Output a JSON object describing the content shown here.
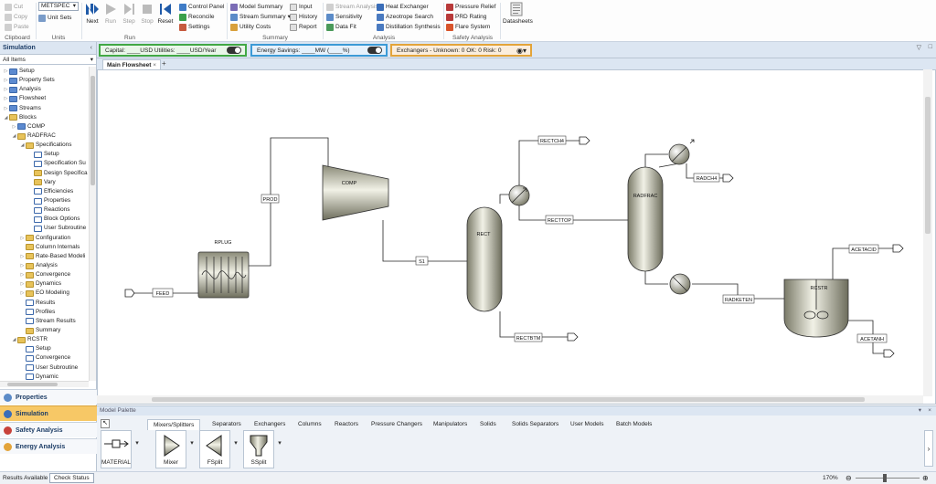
{
  "ribbon": {
    "clipboard": {
      "cut": "Cut",
      "copy": "Copy",
      "paste": "Paste",
      "label": "Clipboard"
    },
    "units": {
      "selected": "METSPEC",
      "unit_sets": "Unit Sets",
      "label": "Units"
    },
    "run": {
      "next": "Next",
      "run": "Run",
      "step": "Step",
      "stop": "Stop",
      "reset": "Reset",
      "label": "Run"
    },
    "run_extra": {
      "control_panel": "Control Panel",
      "reconcile": "Reconcile",
      "settings": "Settings"
    },
    "summary": {
      "model_summary": "Model Summary",
      "stream_summary": "Stream Summary",
      "utility_costs": "Utility Costs",
      "input": "Input",
      "history": "History",
      "report": "Report",
      "label": "Summary"
    },
    "analysis": {
      "stream_analysis": "Stream Analysis",
      "sensitivity": "Sensitivity",
      "data_fit": "Data Fit",
      "heat_exchanger": "Heat Exchanger",
      "azeotrope_search": "Azeotrope Search",
      "distillation_synthesis": "Distillation Synthesis",
      "label": "Analysis"
    },
    "safety": {
      "pressure_relief": "Pressure Relief",
      "prd_rating": "PRD Rating",
      "flare_system": "Flare System",
      "label": "Safety Analysis"
    },
    "datasheets": "Datasheets"
  },
  "navigator": {
    "title": "Simulation",
    "filter": "All Items",
    "tree": [
      {
        "label": "Setup",
        "depth": 0,
        "toggle": "▷",
        "icon": "folder-icon"
      },
      {
        "label": "Property Sets",
        "depth": 0,
        "toggle": "▷",
        "icon": "folder-icon"
      },
      {
        "label": "Analysis",
        "depth": 0,
        "toggle": "▷",
        "icon": "folder-icon"
      },
      {
        "label": "Flowsheet",
        "depth": 0,
        "toggle": "▷",
        "icon": "folder-icon"
      },
      {
        "label": "Streams",
        "depth": 0,
        "toggle": "▷",
        "icon": "folder-icon"
      },
      {
        "label": "Blocks",
        "depth": 0,
        "toggle": "◢",
        "icon": "folder-open-icon"
      },
      {
        "label": "COMP",
        "depth": 1,
        "toggle": "▷",
        "icon": "folder-icon"
      },
      {
        "label": "RADFRAC",
        "depth": 1,
        "toggle": "◢",
        "icon": "folder-open-icon"
      },
      {
        "label": "Specifications",
        "depth": 2,
        "toggle": "◢",
        "icon": "folder-open-icon"
      },
      {
        "label": "Setup",
        "depth": 3,
        "toggle": "",
        "icon": "form-icon"
      },
      {
        "label": "Specification Su",
        "depth": 3,
        "toggle": "",
        "icon": "form-icon"
      },
      {
        "label": "Design Specifica",
        "depth": 3,
        "toggle": "",
        "icon": "folder-open-icon"
      },
      {
        "label": "Vary",
        "depth": 3,
        "toggle": "",
        "icon": "folder-open-icon"
      },
      {
        "label": "Efficiencies",
        "depth": 3,
        "toggle": "",
        "icon": "form-icon"
      },
      {
        "label": "Properties",
        "depth": 3,
        "toggle": "",
        "icon": "form-icon"
      },
      {
        "label": "Reactions",
        "depth": 3,
        "toggle": "",
        "icon": "form-icon"
      },
      {
        "label": "Block Options",
        "depth": 3,
        "toggle": "",
        "icon": "form-icon"
      },
      {
        "label": "User Subroutine",
        "depth": 3,
        "toggle": "",
        "icon": "form-icon"
      },
      {
        "label": "Configuration",
        "depth": 2,
        "toggle": "▷",
        "icon": "folder-open-icon"
      },
      {
        "label": "Column Internals",
        "depth": 2,
        "toggle": "",
        "icon": "folder-open-icon"
      },
      {
        "label": "Rate-Based Modeli",
        "depth": 2,
        "toggle": "▷",
        "icon": "folder-open-icon"
      },
      {
        "label": "Analysis",
        "depth": 2,
        "toggle": "▷",
        "icon": "folder-open-icon"
      },
      {
        "label": "Convergence",
        "depth": 2,
        "toggle": "▷",
        "icon": "folder-open-icon"
      },
      {
        "label": "Dynamics",
        "depth": 2,
        "toggle": "▷",
        "icon": "folder-open-icon"
      },
      {
        "label": "EO Modeling",
        "depth": 2,
        "toggle": "▷",
        "icon": "folder-open-icon"
      },
      {
        "label": "Results",
        "depth": 2,
        "toggle": "",
        "icon": "form-icon"
      },
      {
        "label": "Profiles",
        "depth": 2,
        "toggle": "",
        "icon": "form-icon"
      },
      {
        "label": "Stream Results",
        "depth": 2,
        "toggle": "",
        "icon": "form-icon"
      },
      {
        "label": "Summary",
        "depth": 2,
        "toggle": "",
        "icon": "folder-open-icon"
      },
      {
        "label": "RCSTR",
        "depth": 1,
        "toggle": "◢",
        "icon": "folder-open-icon"
      },
      {
        "label": "Setup",
        "depth": 2,
        "toggle": "",
        "icon": "form-icon"
      },
      {
        "label": "Convergence",
        "depth": 2,
        "toggle": "",
        "icon": "form-icon"
      },
      {
        "label": "User Subroutine",
        "depth": 2,
        "toggle": "",
        "icon": "form-icon"
      },
      {
        "label": "Dynamic",
        "depth": 2,
        "toggle": "",
        "icon": "form-icon"
      }
    ],
    "buttons": {
      "properties": "Properties",
      "simulation": "Simulation",
      "safety": "Safety Analysis",
      "energy": "Energy Analysis"
    }
  },
  "infobar": {
    "capital_pre": "Capital: ____USD  Utilities: ____USD/Year",
    "energy_pre": "Energy Savings: ____MW  (____%)",
    "exchangers": "Exchangers - Unknown: 0  OK: 0  Risk: 0"
  },
  "tabs": {
    "main": "Main Flowsheet",
    "add": "+"
  },
  "flowsheet": {
    "blocks": {
      "rplug": "RPLUG",
      "comp": "COMP",
      "rect": "RECT",
      "radfrac": "RADFRAC",
      "rcstr": "RCSTR"
    },
    "streams": {
      "feed": "FEED",
      "prod": "PROD",
      "s1": "S1",
      "rectch4": "RECTCH4",
      "recttop": "RECTTOP",
      "rectbtm": "RECTBTM",
      "radch4": "RADCH4",
      "radketen": "RADKETEN",
      "aceticacid": "ACETACID",
      "acetanh": "ACETANH"
    }
  },
  "palette": {
    "title": "Model Palette",
    "tabs": [
      "Mixers/Splitters",
      "Separators",
      "Exchangers",
      "Columns",
      "Reactors",
      "Pressure Changers",
      "Manipulators",
      "Solids",
      "Solids Separators",
      "User Models",
      "Batch Models"
    ],
    "items": {
      "material": "MATERIAL",
      "mixer": "Mixer",
      "fsplit": "FSplit",
      "ssplit": "SSplit"
    }
  },
  "status": {
    "results": "Results Available",
    "check_status": "Check Status",
    "zoom": "170%"
  }
}
